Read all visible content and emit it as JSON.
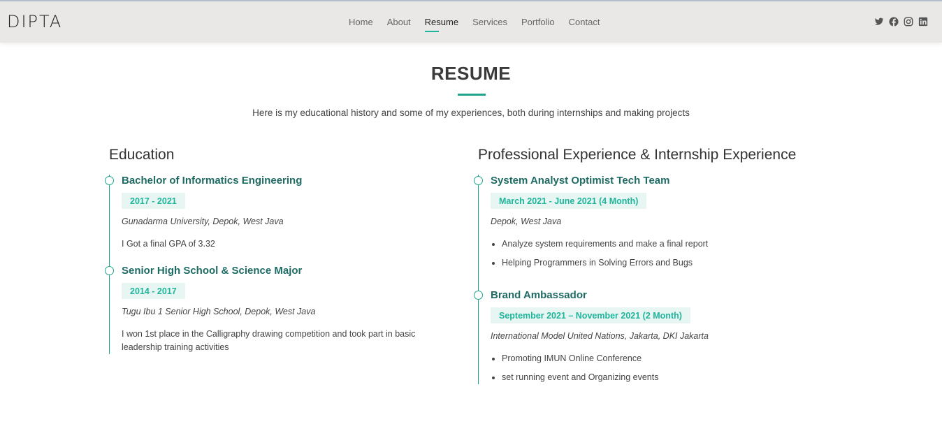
{
  "header": {
    "logo": "DIPTA",
    "nav": [
      "Home",
      "About",
      "Resume",
      "Services",
      "Portfolio",
      "Contact"
    ],
    "active_nav": "Resume",
    "social_icons": [
      "twitter-icon",
      "facebook-icon",
      "instagram-icon",
      "linkedin-icon"
    ]
  },
  "section": {
    "title": "RESUME",
    "subtitle": "Here is my educational history and some of my experiences, both during internships and making projects"
  },
  "education": {
    "title": "Education",
    "items": [
      {
        "title": "Bachelor of Informatics Engineering",
        "date": "2017 - 2021",
        "place": "Gunadarma University, Depok, West Java",
        "desc": "I Got a final GPA of 3.32"
      },
      {
        "title": "Senior High School & Science Major",
        "date": "2014 - 2017",
        "place": "Tugu Ibu 1 Senior High School, Depok, West Java",
        "desc": "I won 1st place in the Calligraphy drawing competition and took part in basic leadership training activities"
      }
    ]
  },
  "experience": {
    "title": "Professional Experience & Internship Experience",
    "items": [
      {
        "title": "System Analyst Optimist Tech Team",
        "date": "March 2021 - June 2021 (4 Month)",
        "place": "Depok, West Java",
        "points": [
          "Analyze system requirements and make a final report",
          "Helping Programmers in Solving Errors and Bugs"
        ]
      },
      {
        "title": "Brand Ambassador",
        "date": "September 2021 – November 2021 (2 Month)",
        "place": "International Model United Nations, Jakarta, DKI Jakarta",
        "points": [
          "Promoting IMUN Online Conference",
          "set running event and Organizing events"
        ]
      }
    ]
  },
  "colors": {
    "accent": "#1fa58c",
    "heading_teal": "#1e6b64",
    "date_bg": "#e8f6f3",
    "header_bg": "#e9e8e6"
  }
}
